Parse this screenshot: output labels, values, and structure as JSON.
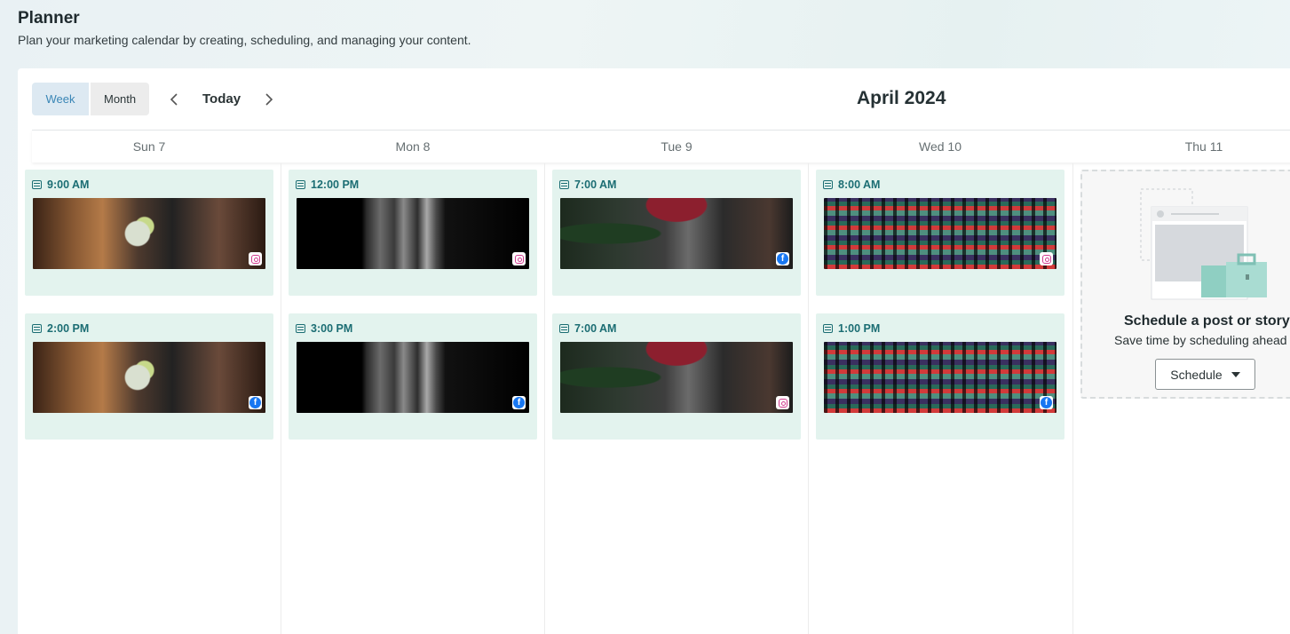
{
  "header": {
    "title": "Planner",
    "subtitle": "Plan your marketing calendar by creating, scheduling, and managing your content."
  },
  "toolbar": {
    "week_label": "Week",
    "month_label": "Month",
    "today_label": "Today",
    "active_view": "Week",
    "month_title": "April 2024",
    "prev_icon": "chevron-left-icon",
    "next_icon": "chevron-right-icon"
  },
  "days": [
    {
      "label": "Sun 7"
    },
    {
      "label": "Mon 8"
    },
    {
      "label": "Tue 9"
    },
    {
      "label": "Wed 10"
    },
    {
      "label": "Thu 11"
    }
  ],
  "posts": {
    "sun": [
      {
        "time": "9:00 AM",
        "platform": "instagram",
        "thumb": "bar cocktail"
      },
      {
        "time": "2:00 PM",
        "platform": "facebook",
        "thumb": "bar cocktail"
      }
    ],
    "mon": [
      {
        "time": "12:00 PM",
        "platform": "instagram",
        "thumb": "coffee machine"
      },
      {
        "time": "3:00 PM",
        "platform": "facebook",
        "thumb": "coffee machine"
      }
    ],
    "tue": [
      {
        "time": "7:00 AM",
        "platform": "facebook",
        "thumb": "red cocktail"
      },
      {
        "time": "7:00 AM",
        "platform": "instagram",
        "thumb": "red cocktail"
      }
    ],
    "wed": [
      {
        "time": "8:00 AM",
        "platform": "instagram",
        "thumb": "neon lights"
      },
      {
        "time": "1:00 PM",
        "platform": "facebook",
        "thumb": "neon lights"
      }
    ]
  },
  "empty_state": {
    "title": "Schedule a post or story",
    "description": "Save time by scheduling ahead",
    "button_label": "Schedule"
  },
  "colors": {
    "card_bg": "#e3f3ee",
    "time_text": "#1b6d73",
    "week_active_bg": "#dde9f2",
    "week_active_text": "#3a86b6",
    "facebook": "#1877f2",
    "instagram": "#d13c8f"
  }
}
